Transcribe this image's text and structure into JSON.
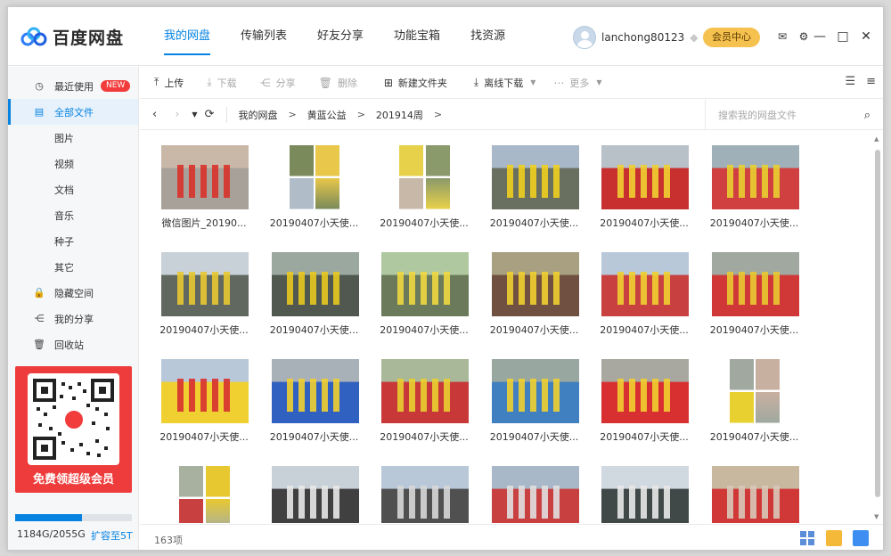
{
  "app": {
    "name": "百度网盘"
  },
  "nav": [
    {
      "label": "我的网盘",
      "active": true
    },
    {
      "label": "传输列表",
      "active": false
    },
    {
      "label": "好友分享",
      "active": false
    },
    {
      "label": "功能宝箱",
      "active": false
    },
    {
      "label": "找资源",
      "active": false
    }
  ],
  "user": {
    "name": "lanchong80123",
    "vip_button": "会员中心"
  },
  "sidebar": {
    "items": [
      {
        "label": "最近使用",
        "icon": "clock-icon",
        "badge": "NEW",
        "sub": false,
        "active": false
      },
      {
        "label": "全部文件",
        "icon": "file-icon",
        "sub": false,
        "active": true
      },
      {
        "label": "图片",
        "sub": true,
        "active": false
      },
      {
        "label": "视频",
        "sub": true,
        "active": false
      },
      {
        "label": "文档",
        "sub": true,
        "active": false
      },
      {
        "label": "音乐",
        "sub": true,
        "active": false
      },
      {
        "label": "种子",
        "sub": true,
        "active": false
      },
      {
        "label": "其它",
        "sub": true,
        "active": false
      },
      {
        "label": "隐藏空间",
        "icon": "lock-icon",
        "sub": false,
        "active": false
      },
      {
        "label": "我的分享",
        "icon": "share-icon",
        "sub": false,
        "active": false
      },
      {
        "label": "回收站",
        "icon": "trash-icon",
        "sub": false,
        "active": false
      }
    ],
    "promo_text": "免费领超级会员",
    "storage": {
      "text": "1184G/2055G",
      "link": "扩容至5T",
      "used_fraction": 0.576
    }
  },
  "toolbar": {
    "upload": "上传",
    "download": "下载",
    "share": "分享",
    "delete": "删除",
    "new_folder": "新建文件夹",
    "offline_download": "离线下载",
    "more": "更多"
  },
  "path": [
    "我的网盘",
    "黄蓝公益",
    "201914周"
  ],
  "search": {
    "placeholder": "搜索我的网盘文件"
  },
  "files": [
    {
      "name": "微信图片_20190...",
      "kind": "photo",
      "palette": [
        "#c9b8a8",
        "#d8322a",
        "#a8a19a"
      ]
    },
    {
      "name": "20190407小天使...",
      "kind": "collage",
      "palette": [
        "#7a8a5a",
        "#e8c74a",
        "#b0bcc8"
      ]
    },
    {
      "name": "20190407小天使...",
      "kind": "collage",
      "palette": [
        "#e8d14a",
        "#8a9a6a",
        "#c8b8a8"
      ]
    },
    {
      "name": "20190407小天使...",
      "kind": "photo",
      "palette": [
        "#a8b8c8",
        "#f0d020",
        "#6a7060"
      ]
    },
    {
      "name": "20190407小天使...",
      "kind": "photo",
      "palette": [
        "#b8c0c8",
        "#f0d030",
        "#c83030"
      ]
    },
    {
      "name": "20190407小天使...",
      "kind": "photo",
      "palette": [
        "#a0b0b8",
        "#e8d030",
        "#d04040"
      ]
    },
    {
      "name": "20190407小天使...",
      "kind": "photo",
      "palette": [
        "#c8d0d8",
        "#e8c830",
        "#606860"
      ]
    },
    {
      "name": "20190407小天使...",
      "kind": "photo",
      "palette": [
        "#9aa8a0",
        "#e8c820",
        "#505850"
      ]
    },
    {
      "name": "20190407小天使...",
      "kind": "photo",
      "palette": [
        "#b0c8a0",
        "#f0d840",
        "#6a7a5a"
      ]
    },
    {
      "name": "20190407小天使...",
      "kind": "photo",
      "palette": [
        "#a8a080",
        "#f0d030",
        "#705040"
      ]
    },
    {
      "name": "20190407小天使...",
      "kind": "photo",
      "palette": [
        "#b8c8d8",
        "#f0d030",
        "#c84040"
      ]
    },
    {
      "name": "20190407小天使...",
      "kind": "photo",
      "palette": [
        "#a0a8a0",
        "#e8c830",
        "#d03838"
      ]
    },
    {
      "name": "20190407小天使...",
      "kind": "photo",
      "palette": [
        "#b8c8d8",
        "#d83030",
        "#f0d030"
      ]
    },
    {
      "name": "20190407小天使...",
      "kind": "photo",
      "palette": [
        "#a8b0b8",
        "#f0d030",
        "#3060c0"
      ]
    },
    {
      "name": "20190407小天使...",
      "kind": "photo",
      "palette": [
        "#a8b898",
        "#e8d030",
        "#c83838"
      ]
    },
    {
      "name": "20190407小天使...",
      "kind": "photo",
      "palette": [
        "#98a8a0",
        "#f0d030",
        "#4080c0"
      ]
    },
    {
      "name": "20190407小天使...",
      "kind": "photo",
      "palette": [
        "#a8a8a0",
        "#f0d030",
        "#d83030"
      ]
    },
    {
      "name": "20190407小天使...",
      "kind": "collage",
      "palette": [
        "#a0a8a0",
        "#c8b0a0",
        "#e8d030"
      ]
    },
    {
      "name": "",
      "kind": "collage",
      "palette": [
        "#a8b0a0",
        "#e8c830",
        "#c84040"
      ]
    },
    {
      "name": "",
      "kind": "photo",
      "palette": [
        "#c8d0d8",
        "#e8e8e8",
        "#404040"
      ]
    },
    {
      "name": "",
      "kind": "photo",
      "palette": [
        "#b8c8d8",
        "#d8d8d8",
        "#505050"
      ]
    },
    {
      "name": "",
      "kind": "photo",
      "palette": [
        "#a8b8c8",
        "#e0e0e0",
        "#c84040"
      ]
    },
    {
      "name": "",
      "kind": "photo",
      "palette": [
        "#d0d8e0",
        "#e8e8e8",
        "#404848"
      ]
    },
    {
      "name": "",
      "kind": "photo",
      "palette": [
        "#c8b8a0",
        "#d8c8b8",
        "#d03838"
      ]
    }
  ],
  "status": {
    "count": "163项"
  },
  "colors": {
    "accent": "#0683e1",
    "vip": "#f5c14f",
    "promo": "#ee3b3b"
  }
}
